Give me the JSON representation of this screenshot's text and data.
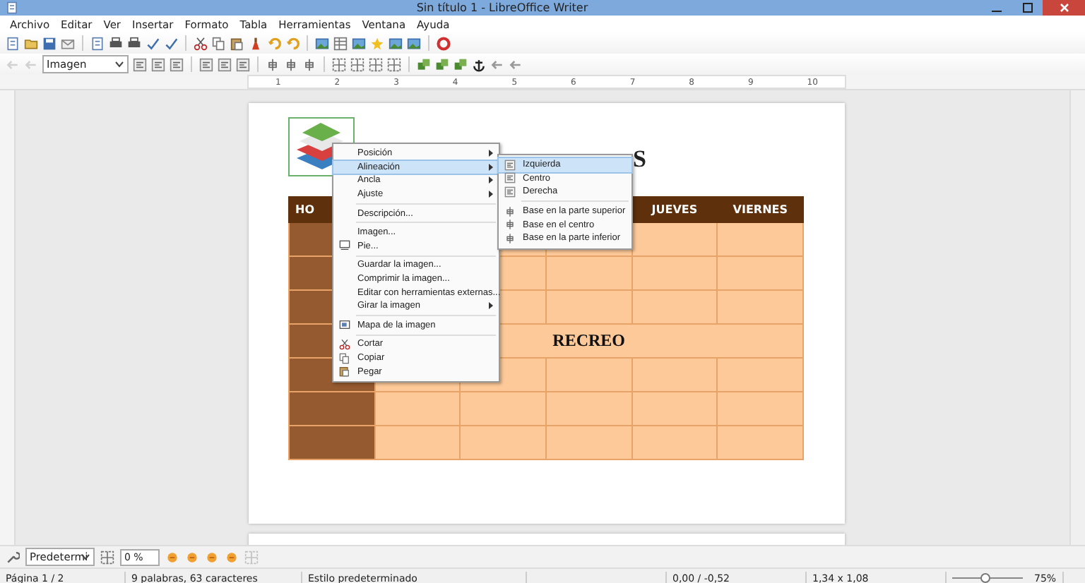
{
  "window": {
    "title": "Sin título 1 - LibreOffice Writer"
  },
  "menu_bar": [
    "Archivo",
    "Editar",
    "Ver",
    "Insertar",
    "Formato",
    "Tabla",
    "Herramientas",
    "Ventana",
    "Ayuda"
  ],
  "frame_toolbar": {
    "style_box": "Imagen"
  },
  "ruler": [
    "1",
    "2",
    "3",
    "4",
    "5",
    "6",
    "7",
    "8",
    "9",
    "10"
  ],
  "document": {
    "heading": "S",
    "table": {
      "columns": [
        {
          "label": "HO"
        },
        {},
        {},
        {},
        {
          "label": "JUEVES"
        },
        {
          "label": "VIERNES"
        }
      ],
      "rows": [
        {
          "kind": "slots"
        },
        {
          "kind": "slots"
        },
        {
          "kind": "slots"
        },
        {
          "kind": "break",
          "label": "RECREO"
        },
        {
          "kind": "slots"
        },
        {
          "kind": "slots"
        },
        {
          "kind": "slots"
        }
      ]
    }
  },
  "context_menu": {
    "items": [
      {
        "kind": "submenu",
        "label": "Posición",
        "selected": false
      },
      {
        "kind": "submenu",
        "label": "Alineación",
        "selected": true
      },
      {
        "kind": "submenu",
        "label": "Ancla",
        "selected": false
      },
      {
        "kind": "submenu",
        "label": "Ajuste",
        "selected": false
      },
      {
        "kind": "separator"
      },
      {
        "kind": "command",
        "label": "Descripción...",
        "selected": false
      },
      {
        "kind": "separator"
      },
      {
        "kind": "command",
        "label": "Imagen...",
        "selected": false
      },
      {
        "kind": "command",
        "label": "Pie...",
        "selected": false
      },
      {
        "kind": "separator"
      },
      {
        "kind": "command",
        "label": "Guardar la imagen...",
        "selected": false
      },
      {
        "kind": "command",
        "label": "Comprimir la imagen...",
        "selected": false
      },
      {
        "kind": "command",
        "label": "Editar con herramientas externas...",
        "selected": false
      },
      {
        "kind": "submenu",
        "label": "Girar la imagen",
        "selected": false
      },
      {
        "kind": "separator"
      },
      {
        "kind": "command",
        "label": "Mapa de la imagen",
        "selected": false
      },
      {
        "kind": "separator"
      },
      {
        "kind": "command",
        "label": "Cortar",
        "selected": false
      },
      {
        "kind": "command",
        "label": "Copiar",
        "selected": false
      },
      {
        "kind": "command",
        "label": "Pegar",
        "selected": false
      }
    ]
  },
  "submenu": {
    "items": [
      {
        "kind": "command",
        "label": "Izquierda",
        "selected": true,
        "disabled": false
      },
      {
        "kind": "command",
        "label": "Centro",
        "selected": false,
        "disabled": false
      },
      {
        "kind": "command",
        "label": "Derecha",
        "selected": false,
        "disabled": false
      },
      {
        "kind": "separator"
      },
      {
        "kind": "command",
        "label": "Base en la parte superior",
        "selected": false,
        "disabled": false
      },
      {
        "kind": "command",
        "label": "Base en el centro",
        "selected": false,
        "disabled": false
      },
      {
        "kind": "command",
        "label": "Base en la parte inferior",
        "selected": false,
        "disabled": false
      }
    ]
  },
  "bottom_toolbar": {
    "style_box": "Predetermi",
    "transparency": "0 %"
  },
  "status_bar": {
    "page": "Página 1 / 2",
    "words": "9 palabras, 63 caracteres",
    "style": "Estilo predeterminado",
    "position": "0,00 / -0,52",
    "size": "1,34 x 1,08",
    "zoom": {
      "level": 0.45,
      "label": "75%"
    }
  }
}
